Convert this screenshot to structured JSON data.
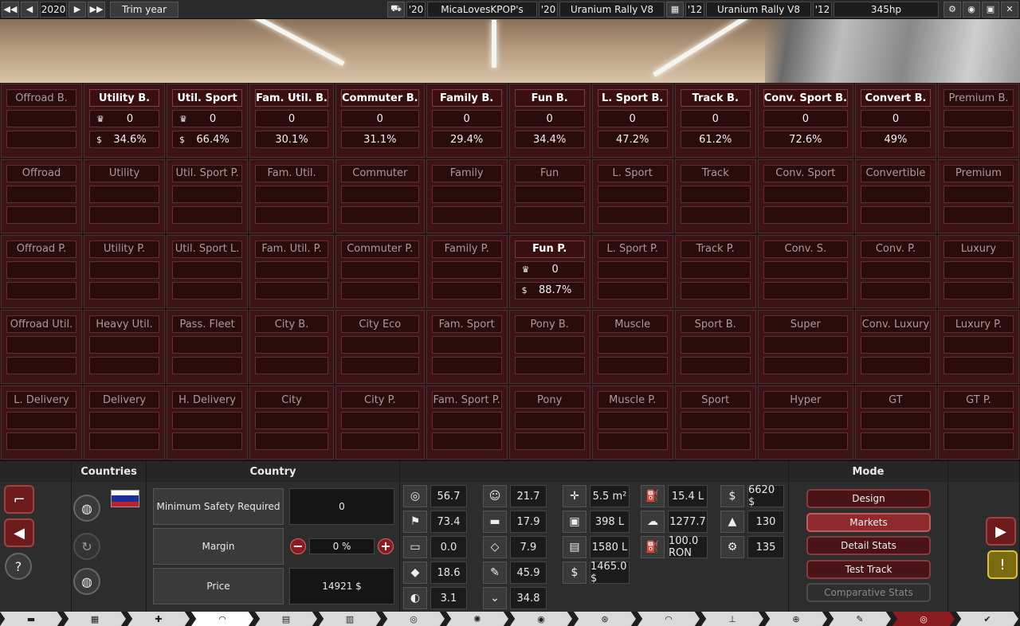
{
  "topbar": {
    "year": "2020",
    "trim_year_label": "Trim year",
    "car_year": "'20",
    "car_name": "MicaLovesKPOP's",
    "trim_year": "'20",
    "trim_name": "Uranium Rally V8",
    "engine_year": "'12",
    "engine_name": "Uranium Rally V8",
    "engine_year2": "'12",
    "power": "345hp",
    "icons": [
      "first-icon",
      "prev-icon",
      "next-icon",
      "last-icon",
      "car-icon",
      "engine-icon",
      "settings-icon",
      "camera-icon",
      "save-icon",
      "close-icon"
    ]
  },
  "markets": [
    [
      {
        "title": "Offroad B.",
        "active": false
      },
      {
        "title": "Utility B.",
        "active": true,
        "trophy": "0",
        "pct": "34.6%"
      },
      {
        "title": "Util. Sport",
        "active": true,
        "trophy": "0",
        "pct": "66.4%"
      },
      {
        "title": "Fam. Util. B.",
        "active": true,
        "trophy": "0",
        "pct": "30.1%",
        "noicons": true
      },
      {
        "title": "Commuter B.",
        "active": true,
        "trophy": "0",
        "pct": "31.1%",
        "noicons": true
      },
      {
        "title": "Family B.",
        "active": true,
        "trophy": "0",
        "pct": "29.4%",
        "noicons": true
      },
      {
        "title": "Fun B.",
        "active": true,
        "trophy": "0",
        "pct": "34.4%",
        "noicons": true
      },
      {
        "title": "L. Sport B.",
        "active": true,
        "trophy": "0",
        "pct": "47.2%",
        "noicons": true
      },
      {
        "title": "Track B.",
        "active": true,
        "trophy": "0",
        "pct": "61.2%",
        "noicons": true
      },
      {
        "title": "Conv. Sport B.",
        "active": true,
        "trophy": "0",
        "pct": "72.6%",
        "noicons": true
      },
      {
        "title": "Convert B.",
        "active": true,
        "trophy": "0",
        "pct": "49%",
        "noicons": true
      },
      {
        "title": "Premium B.",
        "active": false
      }
    ],
    [
      {
        "title": "Offroad"
      },
      {
        "title": "Utility"
      },
      {
        "title": "Util. Sport P."
      },
      {
        "title": "Fam. Util."
      },
      {
        "title": "Commuter"
      },
      {
        "title": "Family"
      },
      {
        "title": "Fun"
      },
      {
        "title": "L. Sport"
      },
      {
        "title": "Track"
      },
      {
        "title": "Conv. Sport"
      },
      {
        "title": "Convertible"
      },
      {
        "title": "Premium"
      }
    ],
    [
      {
        "title": "Offroad P."
      },
      {
        "title": "Utility P."
      },
      {
        "title": "Util. Sport L."
      },
      {
        "title": "Fam. Util. P."
      },
      {
        "title": "Commuter P."
      },
      {
        "title": "Family P."
      },
      {
        "title": "Fun P.",
        "active": true,
        "trophy": "0",
        "pct": "88.7%"
      },
      {
        "title": "L. Sport P."
      },
      {
        "title": "Track P."
      },
      {
        "title": "Conv. S."
      },
      {
        "title": "Conv. P."
      },
      {
        "title": "Luxury"
      }
    ],
    [
      {
        "title": "Offroad Util."
      },
      {
        "title": "Heavy Util."
      },
      {
        "title": "Pass. Fleet"
      },
      {
        "title": "City B."
      },
      {
        "title": "City Eco"
      },
      {
        "title": "Fam. Sport"
      },
      {
        "title": "Pony B."
      },
      {
        "title": "Muscle"
      },
      {
        "title": "Sport B."
      },
      {
        "title": "Super"
      },
      {
        "title": "Conv. Luxury"
      },
      {
        "title": "Luxury P."
      }
    ],
    [
      {
        "title": "L. Delivery"
      },
      {
        "title": "Delivery"
      },
      {
        "title": "H. Delivery"
      },
      {
        "title": "City"
      },
      {
        "title": "City P."
      },
      {
        "title": "Fam. Sport P."
      },
      {
        "title": "Pony"
      },
      {
        "title": "Muscle P."
      },
      {
        "title": "Sport"
      },
      {
        "title": "Hyper"
      },
      {
        "title": "GT"
      },
      {
        "title": "GT P."
      }
    ]
  ],
  "countries": {
    "header": "Countries"
  },
  "country": {
    "header": "Country",
    "min_safety_label": "Minimum Safety Required",
    "min_safety_value": "0",
    "margin_label": "Margin",
    "margin_value": "0 %",
    "price_label": "Price",
    "price_value": "14921 $"
  },
  "stats": [
    {
      "icon": "steering-wheel-icon",
      "glyph": "◎",
      "value": "56.7"
    },
    {
      "icon": "racing-flag-icon",
      "glyph": "⚑",
      "value": "73.4"
    },
    {
      "icon": "seat-icon",
      "glyph": "▭",
      "value": "0.0"
    },
    {
      "icon": "diamond-icon",
      "glyph": "◆",
      "value": "18.6"
    },
    {
      "icon": "safety-badge-icon",
      "glyph": "◐",
      "value": "3.1"
    },
    {
      "icon": "passengers-icon",
      "glyph": "☺",
      "value": "21.7"
    },
    {
      "icon": "utility-truck-icon",
      "glyph": "▬",
      "value": "17.9"
    },
    {
      "icon": "offroad-car-icon",
      "glyph": "◇",
      "value": "7.9"
    },
    {
      "icon": "mechanic-icon",
      "glyph": "✎",
      "value": "45.9"
    },
    {
      "icon": "ramp-icon",
      "glyph": "⌄",
      "value": "34.8"
    },
    {
      "icon": "dimensions-icon",
      "glyph": "✛",
      "value": "5.5 m²"
    },
    {
      "icon": "cargo-volume-icon",
      "glyph": "▣",
      "value": "398 L"
    },
    {
      "icon": "passenger-volume-icon",
      "glyph": "▤",
      "value": "1580 L"
    },
    {
      "icon": "cost-icon",
      "glyph": "$",
      "value": "1465.0 $"
    },
    {
      "icon": "fuel-can-icon",
      "glyph": "⛽",
      "value": "15.4 L"
    },
    {
      "icon": "emissions-icon",
      "glyph": "☁",
      "value": "1277.7"
    },
    {
      "icon": "fuel-pump-icon",
      "glyph": "⛽",
      "value": "100.0 RON"
    },
    {
      "icon": "price-worker-icon",
      "glyph": "$",
      "value": "6620 $"
    },
    {
      "icon": "anvil-icon",
      "glyph": "▲",
      "value": "130"
    },
    {
      "icon": "service-gear-icon",
      "glyph": "⚙",
      "value": "135"
    }
  ],
  "mode": {
    "header": "Mode",
    "buttons": [
      "Design",
      "Markets",
      "Detail Stats",
      "Test Track",
      "Comparative Stats"
    ]
  },
  "bottom_tabs": [
    "car-body-icon",
    "chassis-icon",
    "suspension-icon",
    "body-icon",
    "engine-icon",
    "gearbox-icon",
    "wheels-icon",
    "brakes-icon",
    "tyre-icon",
    "aero-icon",
    "fixtures-icon",
    "interior-icon",
    "safety-icon",
    "paint-icon",
    "test-track-icon",
    "finish-icon"
  ],
  "colors": {
    "accent": "#8e2a2d",
    "cell_bg": "#3d1416"
  }
}
